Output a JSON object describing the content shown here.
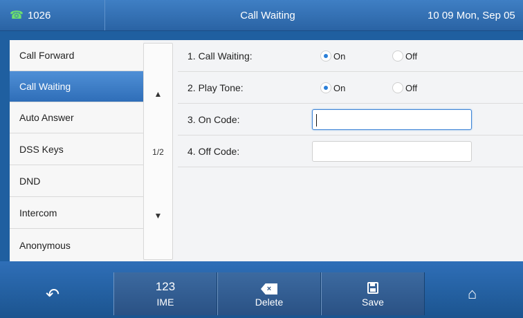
{
  "titlebar": {
    "account": "1026",
    "phone_icon": "phone-icon",
    "title": "Call Waiting",
    "clock": "10 09 Mon, Sep 05"
  },
  "menu": {
    "items": [
      {
        "label": "Call Forward",
        "active": false
      },
      {
        "label": "Call Waiting",
        "active": true
      },
      {
        "label": "Auto Answer",
        "active": false
      },
      {
        "label": "DSS Keys",
        "active": false
      },
      {
        "label": "DND",
        "active": false
      },
      {
        "label": "Intercom",
        "active": false
      },
      {
        "label": "Anonymous",
        "active": false
      }
    ],
    "page": "1/2"
  },
  "form": {
    "call_waiting": {
      "label": "1. Call Waiting:",
      "on": "On",
      "off": "Off",
      "selected": "On"
    },
    "play_tone": {
      "label": "2. Play Tone:",
      "on": "On",
      "off": "Off",
      "selected": "On"
    },
    "on_code": {
      "label": "3. On Code:",
      "value": ""
    },
    "off_code": {
      "label": "4. Off Code:",
      "value": ""
    }
  },
  "softkeys": {
    "ime_top": "123",
    "ime": "IME",
    "delete": "Delete",
    "save": "Save"
  },
  "colors": {
    "accent": "#2f6eb8",
    "titlebar": "#3f7fc4",
    "radio_selected": "#2a7fd8"
  }
}
